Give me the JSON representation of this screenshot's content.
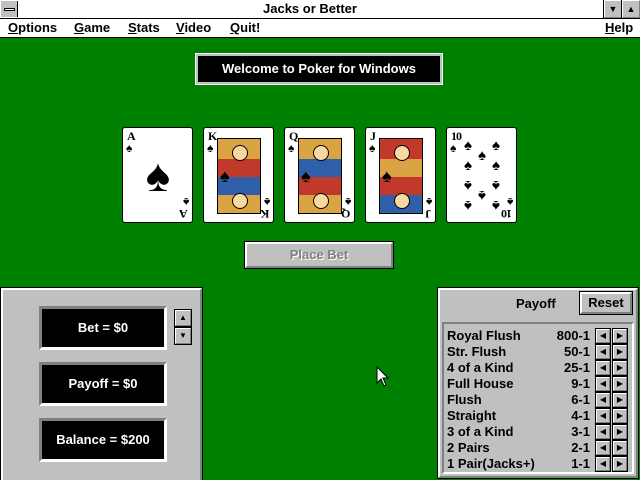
{
  "window": {
    "title": "Jacks or Better"
  },
  "menu": {
    "items": [
      "Options",
      "Game",
      "Stats",
      "Video",
      "Quit!"
    ],
    "help": "Help"
  },
  "banner": {
    "text": "Welcome to Poker for Windows"
  },
  "cards": [
    {
      "rank": "A",
      "suit": "♠",
      "kind": "ace"
    },
    {
      "rank": "K",
      "suit": "♠",
      "kind": "face"
    },
    {
      "rank": "Q",
      "suit": "♠",
      "kind": "face"
    },
    {
      "rank": "J",
      "suit": "♠",
      "kind": "face"
    },
    {
      "rank": "10",
      "suit": "♠",
      "kind": "pips"
    }
  ],
  "place_bet": {
    "label": "Place Bet",
    "enabled": false
  },
  "status": {
    "bet": "Bet = $0",
    "payoff": "Payoff = $0",
    "balance": "Balance = $200"
  },
  "payoff_table": {
    "title": "Payoff",
    "reset_label": "Reset",
    "rows": [
      {
        "hand": "Royal Flush",
        "odds": "800-1"
      },
      {
        "hand": "Str. Flush",
        "odds": "50-1"
      },
      {
        "hand": "4 of a Kind",
        "odds": "25-1"
      },
      {
        "hand": "Full House",
        "odds": "9-1"
      },
      {
        "hand": "Flush",
        "odds": "6-1"
      },
      {
        "hand": "Straight",
        "odds": "4-1"
      },
      {
        "hand": "3 of a Kind",
        "odds": "3-1"
      },
      {
        "hand": "2 Pairs",
        "odds": "2-1"
      },
      {
        "hand": "1 Pair(Jacks+)",
        "odds": "1-1"
      }
    ]
  },
  "colors": {
    "table_green": "#008000",
    "panel_gray": "#c0c0c0",
    "lcd_black": "#000000"
  }
}
